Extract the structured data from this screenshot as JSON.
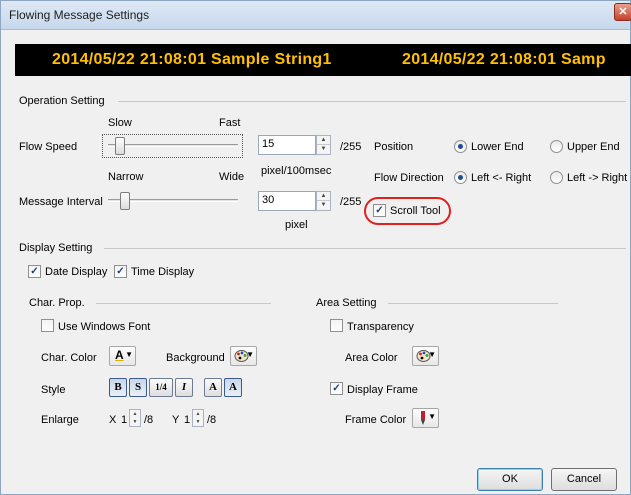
{
  "window": {
    "title": "Flowing Message Settings",
    "close_symbol": "✕"
  },
  "preview": {
    "text1": "2014/05/22 21:08:01 Sample String1",
    "text2": "2014/05/22 21:08:01 Samp"
  },
  "operation": {
    "group_label": "Operation Setting",
    "flow_speed": {
      "label": "Flow Speed",
      "min_label": "Slow",
      "max_label": "Fast",
      "value": "15",
      "max_suffix": "/255",
      "unit": "pixel/100msec"
    },
    "message_interval": {
      "label": "Message Interval",
      "min_label": "Narrow",
      "max_label": "Wide",
      "value": "30",
      "max_suffix": "/255",
      "unit": "pixel"
    },
    "position": {
      "label": "Position",
      "options": [
        "Lower End",
        "Upper End"
      ],
      "selected": "Lower End"
    },
    "flow_direction": {
      "label": "Flow Direction",
      "options": [
        "Left <- Right",
        "Left -> Right"
      ],
      "selected": "Left <- Right"
    },
    "scroll_tool": {
      "label": "Scroll Tool",
      "checked": true
    }
  },
  "display": {
    "group_label": "Display Setting",
    "date_display": {
      "label": "Date Display",
      "checked": true
    },
    "time_display": {
      "label": "Time Display",
      "checked": true
    }
  },
  "char_prop": {
    "group_label": "Char. Prop.",
    "use_windows_font": {
      "label": "Use Windows Font",
      "checked": false
    },
    "char_color_label": "Char. Color",
    "char_color_glyph": "A",
    "background_label": "Background",
    "style_label": "Style",
    "style_buttons": [
      "B",
      "S",
      "1/4",
      "I",
      "A",
      "A"
    ],
    "enlarge_label": "Enlarge",
    "enlarge_x_label": "X",
    "enlarge_x_value": "1",
    "enlarge_y_label": "Y",
    "enlarge_y_value": "1",
    "enlarge_suffix": "/8"
  },
  "area": {
    "group_label": "Area Setting",
    "transparency": {
      "label": "Transparency",
      "checked": false
    },
    "area_color_label": "Area Color",
    "display_frame": {
      "label": "Display Frame",
      "checked": true
    },
    "frame_color_label": "Frame Color"
  },
  "buttons": {
    "ok": "OK",
    "cancel": "Cancel"
  },
  "colors": {
    "preview_text": "#ffc000",
    "preview_bg": "#000000",
    "highlight": "#e0201c",
    "char_color_bar": "#e8b000",
    "frame_color": "#c0202a"
  }
}
